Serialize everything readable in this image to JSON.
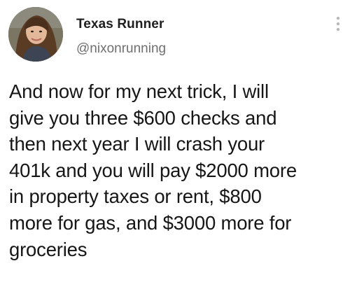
{
  "author": {
    "display_name": "Texas Runner",
    "handle": "@nixonrunning",
    "avatar_icon": "profile-photo"
  },
  "tweet": {
    "text": "And now for my next trick, I will\ngive you three $600 checks and\nthen next year I will crash your\n401k and you will pay $2000 more\nin property taxes or rent, $800\nmore for gas, and $3000 more for\ngroceries"
  },
  "menu": {
    "icon": "more-vertical-icon"
  },
  "colors": {
    "name": "#1f1f1f",
    "handle": "#6f6f6f",
    "text": "#161616",
    "menu_dots": "#b5b5b5"
  }
}
